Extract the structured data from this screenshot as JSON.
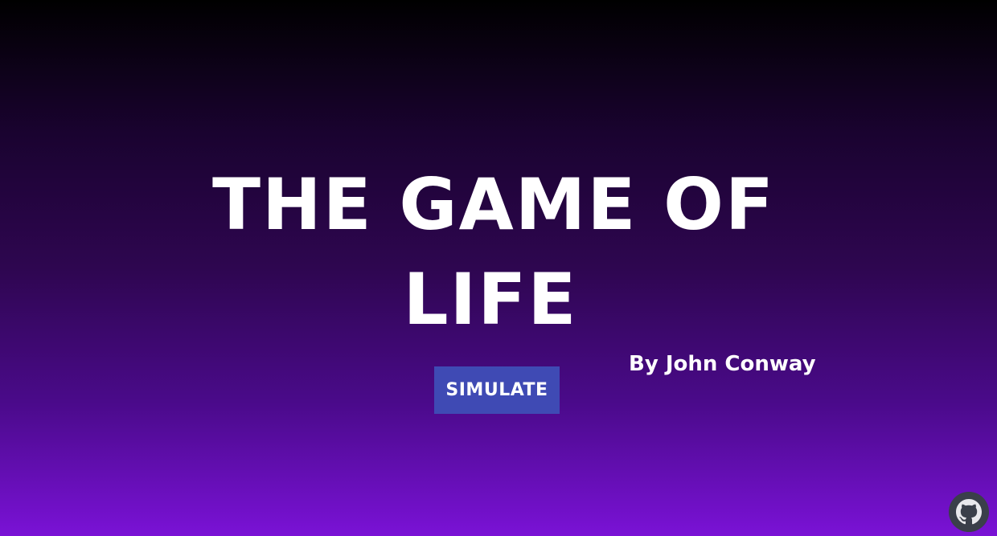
{
  "hero": {
    "title_line1": "THE GAME OF",
    "title_line2": "LIFE",
    "byline": "By John Conway"
  },
  "actions": {
    "simulate_label": "SIMULATE"
  },
  "footer": {
    "github_icon": "github-icon"
  },
  "colors": {
    "gradient_top": "#000000",
    "gradient_bottom": "#7a12d6",
    "button_bg": "#3f4ab4",
    "text": "#ffffff"
  }
}
